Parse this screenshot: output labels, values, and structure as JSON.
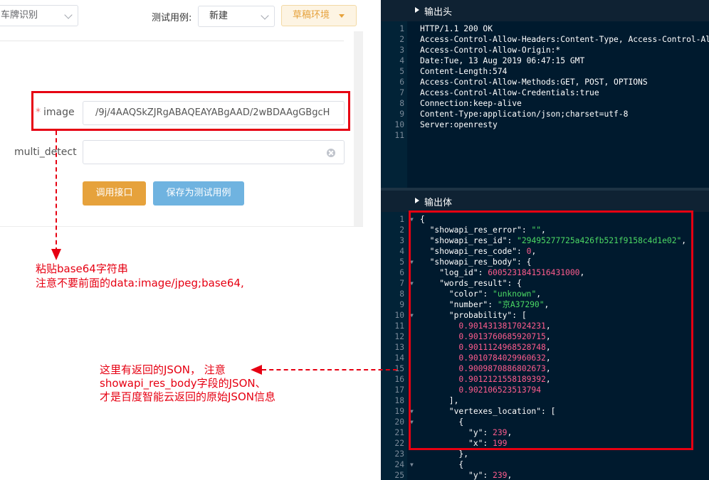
{
  "topbar": {
    "api_select": "车牌识别",
    "case_label": "测试用例:",
    "case_select": "新建",
    "env_button": "草稿环境"
  },
  "form": {
    "image_label": "image",
    "image_required": "*",
    "image_value": "/9j/4AAQSkZJRgABAQEAYABgAAD/2wBDAAgGBgcH",
    "multi_detect_label": "multi_detect",
    "call_button": "调用接口",
    "save_button": "保存为测试用例"
  },
  "annotations": {
    "paste_line1": "粘贴base64字符串",
    "paste_line2": "注意不要前面的data:image/jpeg;base64,",
    "json_line1": "这里有返回的JSON， 注意",
    "json_line2": "showapi_res_body字段的JSON、",
    "json_line3": "才是百度智能云返回的原始JSON信息"
  },
  "output_header": {
    "title": "输出头",
    "lines": [
      "HTTP/1.1 200 OK",
      "Access-Control-Allow-Headers:Content-Type, Access-Control-Allow-Origin",
      "Access-Control-Allow-Origin:*",
      "Date:Tue, 13 Aug 2019 06:47:15 GMT",
      "Content-Length:574",
      "Access-Control-Allow-Methods:GET, POST, OPTIONS",
      "Access-Control-Allow-Credentials:true",
      "Connection:keep-alive",
      "Content-Type:application/json;charset=utf-8",
      "Server:openresty",
      ""
    ]
  },
  "output_body": {
    "title": "输出体",
    "lines": [
      {
        "t": [
          [
            "p",
            "{"
          ]
        ],
        "fold": true
      },
      {
        "t": [
          [
            "k",
            "  \"showapi_res_error\""
          ],
          [
            "p",
            ": "
          ],
          [
            "s",
            "\"\""
          ],
          [
            "p",
            ","
          ]
        ]
      },
      {
        "t": [
          [
            "k",
            "  \"showapi_res_id\""
          ],
          [
            "p",
            ": "
          ],
          [
            "s",
            "\"29495277725a426fb521f9158c4d1e02\""
          ],
          [
            "p",
            ","
          ]
        ]
      },
      {
        "t": [
          [
            "k",
            "  \"showapi_res_code\""
          ],
          [
            "p",
            ": "
          ],
          [
            "n",
            "0"
          ],
          [
            "p",
            ","
          ]
        ]
      },
      {
        "t": [
          [
            "k",
            "  \"showapi_res_body\""
          ],
          [
            "p",
            ": {"
          ]
        ],
        "fold": true
      },
      {
        "t": [
          [
            "k",
            "    \"log_id\""
          ],
          [
            "p",
            ": "
          ],
          [
            "n",
            "6005231841516431000"
          ],
          [
            "p",
            ","
          ]
        ]
      },
      {
        "t": [
          [
            "k",
            "    \"words_result\""
          ],
          [
            "p",
            ": {"
          ]
        ],
        "fold": true
      },
      {
        "t": [
          [
            "k",
            "      \"color\""
          ],
          [
            "p",
            ": "
          ],
          [
            "s",
            "\"unknown\""
          ],
          [
            "p",
            ","
          ]
        ]
      },
      {
        "t": [
          [
            "k",
            "      \"number\""
          ],
          [
            "p",
            ": "
          ],
          [
            "s",
            "\"京A37290\""
          ],
          [
            "p",
            ","
          ]
        ]
      },
      {
        "t": [
          [
            "k",
            "      \"probability\""
          ],
          [
            "p",
            ": ["
          ]
        ],
        "fold": true
      },
      {
        "t": [
          [
            "n",
            "        0.9014313817024231"
          ],
          [
            "p",
            ","
          ]
        ]
      },
      {
        "t": [
          [
            "n",
            "        0.9013760685920715"
          ],
          [
            "p",
            ","
          ]
        ]
      },
      {
        "t": [
          [
            "n",
            "        0.9011124968528748"
          ],
          [
            "p",
            ","
          ]
        ]
      },
      {
        "t": [
          [
            "n",
            "        0.9010784029960632"
          ],
          [
            "p",
            ","
          ]
        ]
      },
      {
        "t": [
          [
            "n",
            "        0.9009870886802673"
          ],
          [
            "p",
            ","
          ]
        ]
      },
      {
        "t": [
          [
            "n",
            "        0.9012121558189392"
          ],
          [
            "p",
            ","
          ]
        ]
      },
      {
        "t": [
          [
            "n",
            "        0.902106523513794"
          ]
        ]
      },
      {
        "t": [
          [
            "p",
            "      ],"
          ]
        ]
      },
      {
        "t": [
          [
            "k",
            "      \"vertexes_location\""
          ],
          [
            "p",
            ": ["
          ]
        ],
        "fold": true
      },
      {
        "t": [
          [
            "p",
            "        {"
          ]
        ],
        "fold": true
      },
      {
        "t": [
          [
            "k",
            "          \"y\""
          ],
          [
            "p",
            ": "
          ],
          [
            "n",
            "239"
          ],
          [
            "p",
            ","
          ]
        ]
      },
      {
        "t": [
          [
            "k",
            "          \"x\""
          ],
          [
            "p",
            ": "
          ],
          [
            "n",
            "199"
          ]
        ]
      },
      {
        "t": [
          [
            "p",
            "        },"
          ]
        ]
      },
      {
        "t": [
          [
            "p",
            "        {"
          ]
        ],
        "fold": true
      },
      {
        "t": [
          [
            "k",
            "          \"y\""
          ],
          [
            "p",
            ": "
          ],
          [
            "n",
            "239"
          ],
          [
            "p",
            ","
          ]
        ]
      }
    ]
  }
}
